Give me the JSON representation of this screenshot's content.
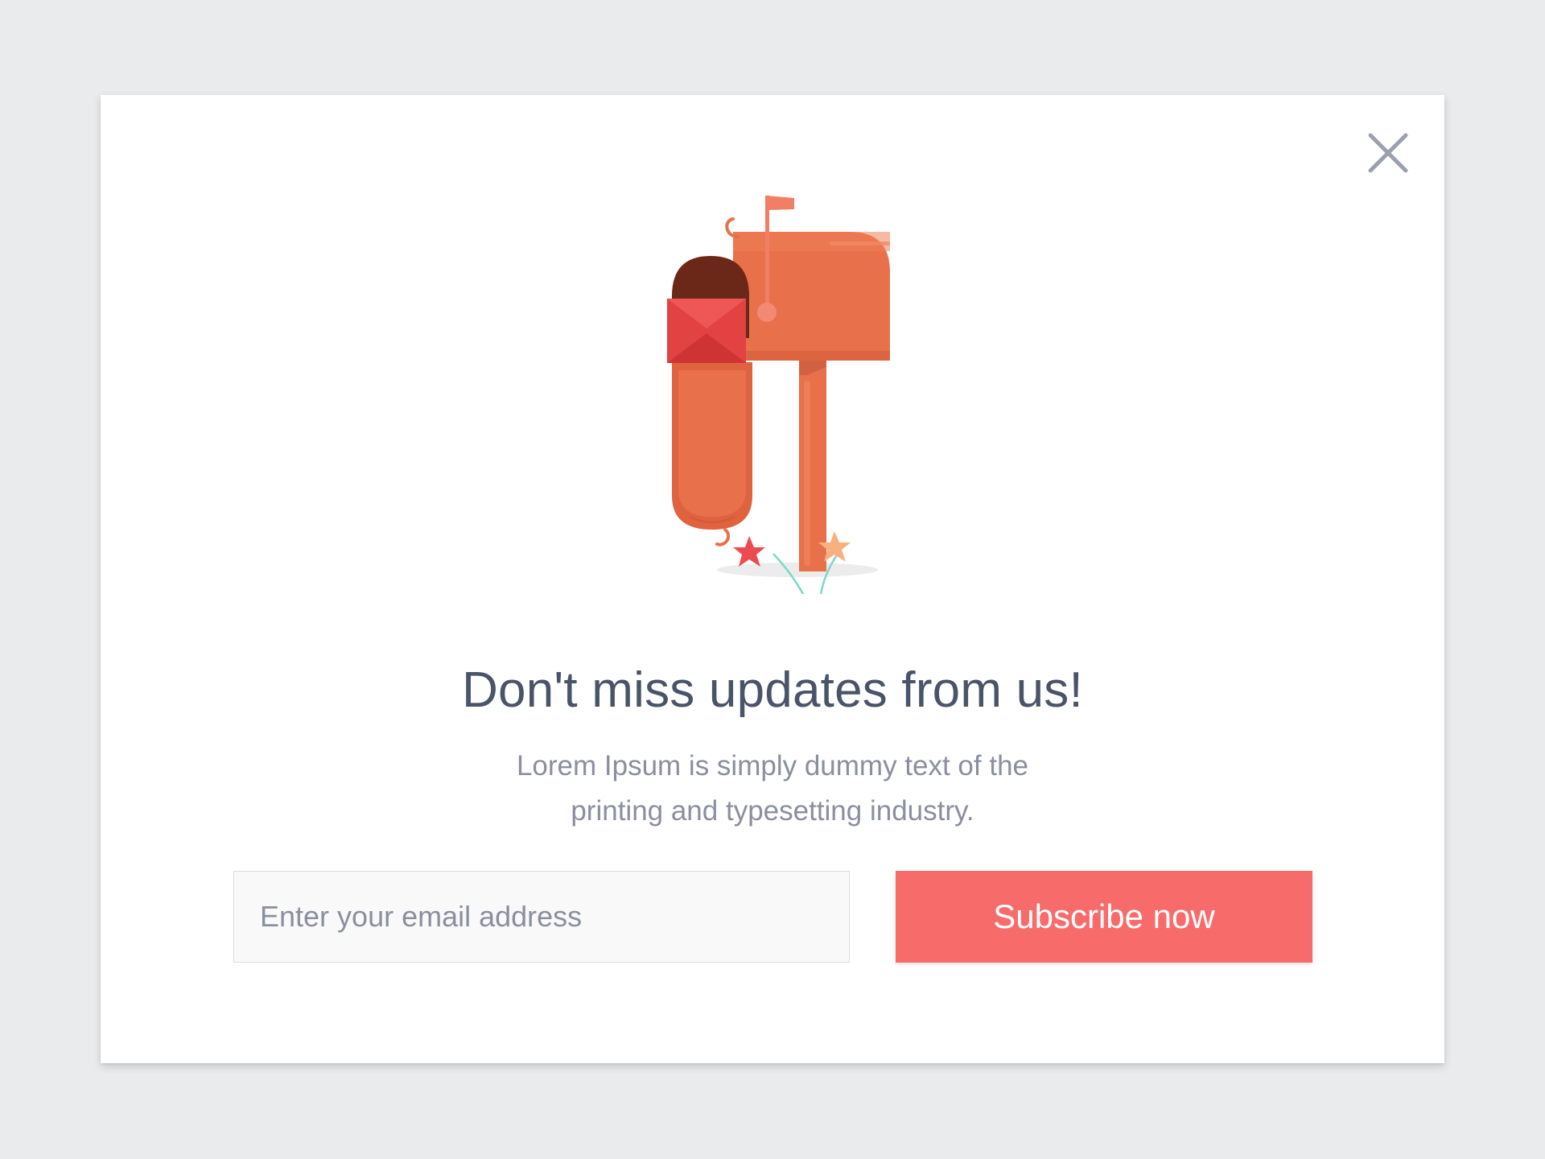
{
  "modal": {
    "close_icon": "close-icon",
    "illustration_icon": "mailbox-illustration-icon",
    "headline": "Don't miss updates from us!",
    "description": "Lorem Ipsum is simply dummy text of the printing and typesetting industry.",
    "email_input": {
      "placeholder": "Enter your email address",
      "value": ""
    },
    "subscribe_label": "Subscribe now"
  },
  "colors": {
    "background": "#eaebed",
    "modal": "#ffffff",
    "accent": "#f76b6b",
    "mailbox": "#e8704a",
    "headline_text": "#4a5468",
    "body_text": "#8a8f9f",
    "close_icon": "#9aa0ad"
  }
}
